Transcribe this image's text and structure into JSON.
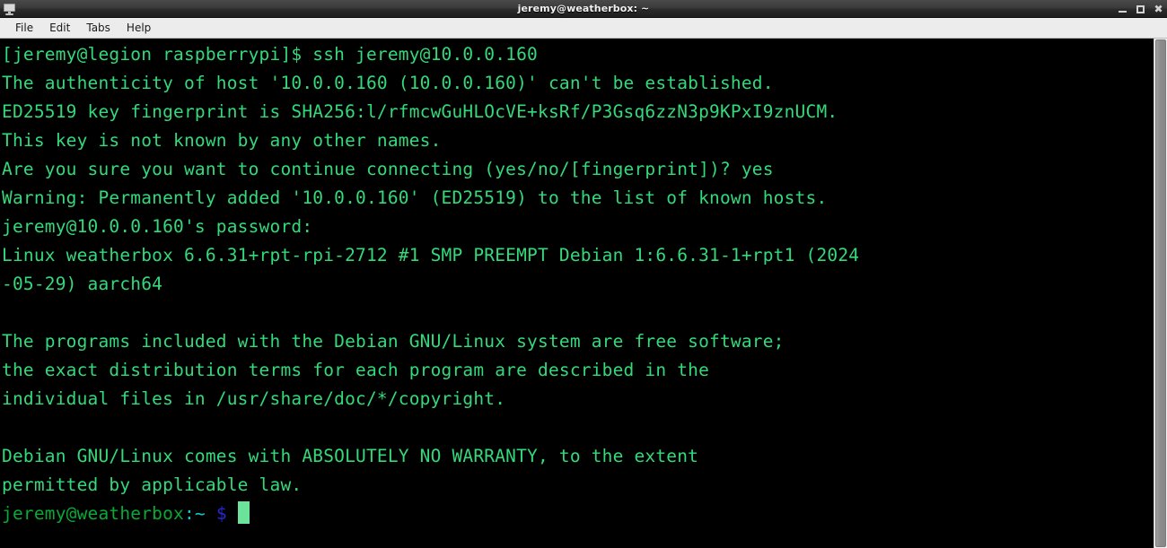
{
  "window": {
    "title": "jeremy@weatherbox: ~",
    "icon": "terminal-monitor-icon",
    "controls": {
      "minimize": "_",
      "maximize": "□",
      "close": "✖"
    }
  },
  "menubar": {
    "items": [
      {
        "label": "File"
      },
      {
        "label": "Edit"
      },
      {
        "label": "Tabs"
      },
      {
        "label": "Help"
      }
    ]
  },
  "terminal": {
    "colors": {
      "background": "#000000",
      "foreground": "#34d97a",
      "prompt_user_host": "#08aa34",
      "prompt_path": "#14c9c9",
      "prompt_symbol": "#2727d6",
      "cursor": "#6be39a"
    },
    "lines": [
      {
        "text": "[jeremy@legion raspberrypi]$ ssh jeremy@10.0.0.160"
      },
      {
        "text": "The authenticity of host '10.0.0.160 (10.0.0.160)' can't be established."
      },
      {
        "text": "ED25519 key fingerprint is SHA256:l/rfmcwGuHLOcVE+ksRf/P3Gsq6zzN3p9KPxI9znUCM."
      },
      {
        "text": "This key is not known by any other names."
      },
      {
        "text": "Are you sure you want to continue connecting (yes/no/[fingerprint])? yes"
      },
      {
        "text": "Warning: Permanently added '10.0.0.160' (ED25519) to the list of known hosts."
      },
      {
        "text": "jeremy@10.0.0.160's password:"
      },
      {
        "text": "Linux weatherbox 6.6.31+rpt-rpi-2712 #1 SMP PREEMPT Debian 1:6.6.31-1+rpt1 (2024"
      },
      {
        "text": "-05-29) aarch64"
      },
      {
        "text": ""
      },
      {
        "text": "The programs included with the Debian GNU/Linux system are free software;"
      },
      {
        "text": "the exact distribution terms for each program are described in the"
      },
      {
        "text": "individual files in /usr/share/doc/*/copyright."
      },
      {
        "text": ""
      },
      {
        "text": "Debian GNU/Linux comes with ABSOLUTELY NO WARRANTY, to the extent"
      },
      {
        "text": "permitted by applicable law."
      }
    ],
    "prompt": {
      "user_host": "jeremy@weatherbox",
      "path": ":~",
      "symbol": "$",
      "cursor": "block"
    }
  },
  "scrollbar": {
    "orientation": "vertical",
    "thumb_position": "full"
  }
}
